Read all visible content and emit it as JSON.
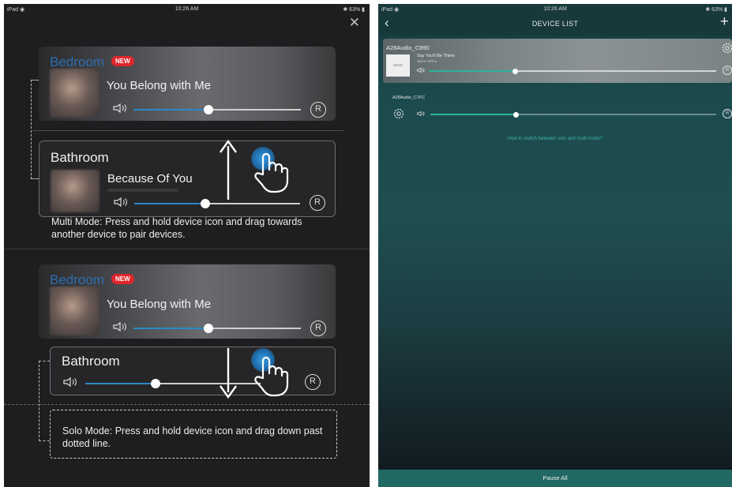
{
  "left": {
    "status": {
      "carrier": "iPad ◉",
      "time": "10:26 AM",
      "battery": "✱ 63% ▮"
    },
    "close_glyph": "✕",
    "multi": {
      "card1": {
        "room": "Bedroom",
        "badge": "NEW",
        "song": "You Belong with Me",
        "volume": 0.45,
        "r": "R"
      },
      "card2": {
        "room": "Bathroom",
        "song": "Because Of You",
        "volume": 0.43,
        "r": "R"
      },
      "hint": "Multi Mode: Press and hold device icon and drag towards another device to pair devices."
    },
    "solo": {
      "card1": {
        "room": "Bedroom",
        "badge": "NEW",
        "song": "You Belong with Me",
        "volume": 0.45,
        "r": "R"
      },
      "card2": {
        "room": "Bathroom",
        "volume": 0.4,
        "r": "R"
      },
      "hint": "Solo Mode: Press and hold device icon and drag down past dotted line."
    },
    "icons": [
      "close-icon",
      "speaker-icon",
      "hand-pointer-icon",
      "arrow-up-icon",
      "arrow-down-icon"
    ]
  },
  "right": {
    "status": {
      "carrier": "iPad ◉",
      "time": "10:26 AM",
      "battery": "✱ 63% ▮"
    },
    "nav": {
      "back": "‹",
      "title": "DEVICE LIST",
      "add": "+"
    },
    "device1": {
      "name": "A28Audio_C890",
      "song": "Say You'll Be There",
      "artist": "Spice Girls ▸",
      "art_text": "SPICE",
      "volume": 0.3,
      "r": "R"
    },
    "device2": {
      "name": "A28Audio_C7FC",
      "volume": 0.3,
      "r": "R"
    },
    "how_link": "How to switch between solo and multi mode?",
    "footer": "Pause All",
    "accent_color": "#2bb39a",
    "icons": [
      "chevron-left-icon",
      "plus-icon",
      "gear-icon",
      "speaker-icon"
    ]
  }
}
